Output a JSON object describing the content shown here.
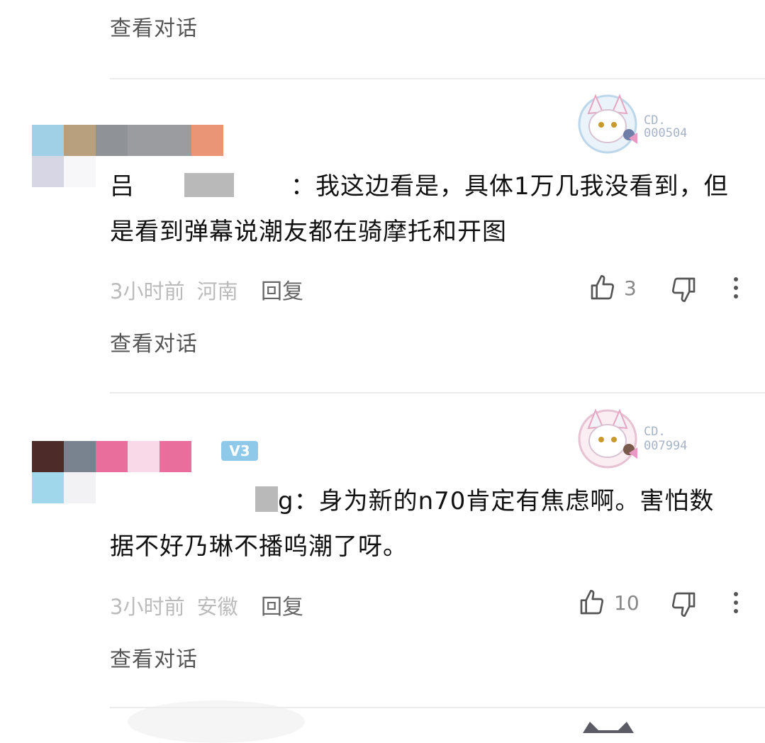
{
  "comments": [
    {
      "view_conversation": "查看对话"
    },
    {
      "username_visible": "吕",
      "text": "：我这边看是，具体1万几我没看到，但是看到弹幕说潮友都在骑摩托和开图",
      "time": "3小时前",
      "location": "河南",
      "reply": "回复",
      "likes": "3",
      "badge_label": "CD.",
      "badge_number": "000504",
      "view_conversation": "查看对话",
      "avatar_colors": [
        "#9fd0e6",
        "#b8a07f",
        "#8f9297",
        "#9a9ca0",
        "#9a9ca0",
        "#ea9575",
        "#d7d6e4",
        "#f7f6f9"
      ]
    },
    {
      "username_visible": "g",
      "text": "：身为新的n70肯定有焦虑啊。害怕数据不好乃琳不播呜潮了呀。",
      "time": "3小时前",
      "location": "安徽",
      "reply": "回复",
      "likes": "10",
      "badge_label": "CD.",
      "badge_number": "007994",
      "level_badge": "V3",
      "view_conversation": "查看对话",
      "avatar_colors": [
        "#4c2b28",
        "#78838f",
        "#ea6e9c",
        "#f9d9e7",
        "#ea6e9c",
        "#ffffff",
        "#a1d7ea",
        "#f2f2f4"
      ]
    }
  ],
  "icons": {
    "like": "thumb-up-icon",
    "dislike": "thumb-down-icon",
    "more": "vertical-ellipsis-icon"
  }
}
